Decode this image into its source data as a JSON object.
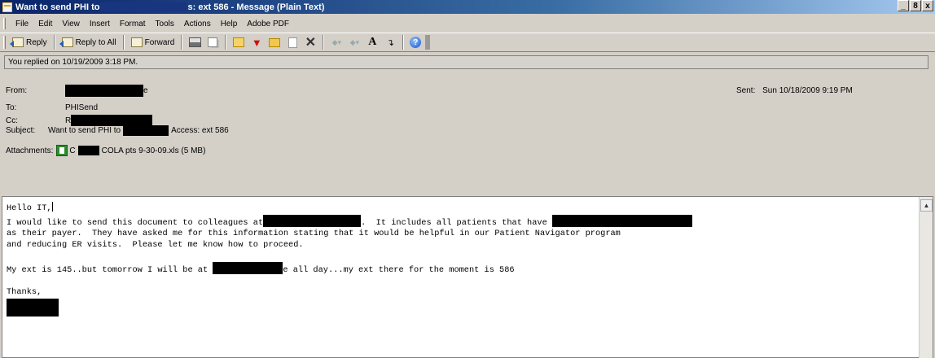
{
  "window": {
    "title_part1": "Want to send PHI to ",
    "title_part2": "s: ext 586 - Message (Plain Text)",
    "controls": [
      "_",
      "8",
      "x"
    ]
  },
  "menu": [
    "File",
    "Edit",
    "View",
    "Insert",
    "Format",
    "Tools",
    "Actions",
    "Help",
    "Adobe PDF"
  ],
  "toolbar": {
    "reply": "Reply",
    "reply_all": "Reply to All",
    "forward": "Forward",
    "icons": [
      "print-icon",
      "copy-icon",
      "move-icon",
      "flag-icon",
      "folder-icon",
      "doc-icon",
      "delete-icon",
      "up-icon",
      "down-icon",
      "font-size-icon",
      "address-book-icon",
      "help-icon"
    ]
  },
  "infobar": "You replied on 10/19/2009 3:18 PM.",
  "header": {
    "from_label": "From:",
    "from_suffix": "e",
    "sent_label": "Sent:",
    "sent_value": "Sun 10/18/2009 9:19 PM",
    "to_label": "To:",
    "to_value": "PHISend",
    "cc_label": "Cc:",
    "cc_prefix": "R",
    "subject_label": "Subject:",
    "subject_part1": "Want to send PHI to",
    "subject_part2": "Access: ext 586",
    "attachments_label": "Attachments:",
    "attachment_prefix": "C",
    "attachment_name": "COLA pts 9-30-09.xls (5 MB)"
  },
  "body": {
    "greeting": "Hello IT,",
    "line2_a": "I would like to send this document to colleagues at",
    "line2_b": ".  It includes all patients that have",
    "line3": "as their payer.  They have asked me for this information stating that it would be helpful in our Patient Navigator program",
    "line4": "and reducing ER visits.  Please let me know how to proceed.",
    "line6_a": "My ext is 145..but tomorrow I will be at",
    "line6_b": "e all day...my ext there for the moment is 586",
    "closing": "Thanks,"
  }
}
